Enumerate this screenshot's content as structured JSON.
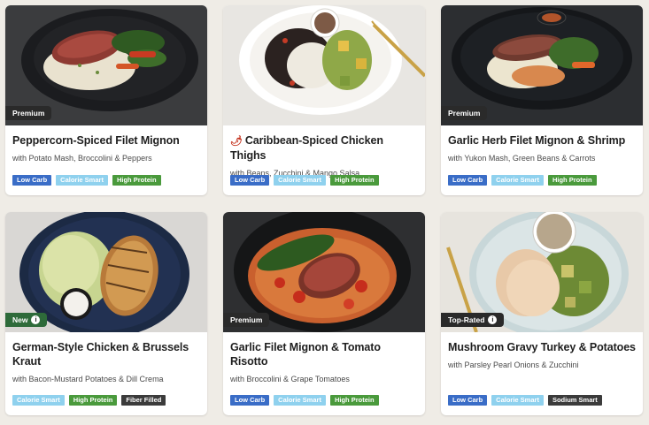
{
  "colors": {
    "page_bg": "#efece6",
    "low_carb": "#3a6dc7",
    "calorie_smart": "#8fd1ee",
    "high_protein": "#4a9a3c",
    "dark_badge": "#3b3b3b",
    "new_tag": "#2e6b3a"
  },
  "cards": [
    {
      "tag": "Premium",
      "title": "Peppercorn-Spiced Filet Mignon",
      "subtitle": "with Potato Mash, Broccolini & Peppers",
      "badges": [
        "Low Carb",
        "Calorie Smart",
        "High Protein"
      ]
    },
    {
      "tag": "",
      "icon": "chili-pepper-icon",
      "title": "Caribbean-Spiced Chicken Thighs",
      "subtitle": "with Beans, Zucchini & Mango Salsa",
      "badges": [
        "Low Carb",
        "Calorie Smart",
        "High Protein"
      ]
    },
    {
      "tag": "Premium",
      "title": "Garlic Herb Filet Mignon & Shrimp",
      "subtitle": "with Yukon Mash, Green Beans & Carrots",
      "badges": [
        "Low Carb",
        "Calorie Smart",
        "High Protein"
      ]
    },
    {
      "tag": "New",
      "title": "German-Style Chicken & Brussels Kraut",
      "subtitle": "with Bacon-Mustard Potatoes & Dill Crema",
      "badges": [
        "Calorie Smart",
        "High Protein",
        "Fiber Filled"
      ]
    },
    {
      "tag": "Premium",
      "title": "Garlic Filet Mignon & Tomato Risotto",
      "subtitle": "with Broccolini & Grape Tomatoes",
      "badges": [
        "Low Carb",
        "Calorie Smart",
        "High Protein"
      ]
    },
    {
      "tag": "Top-Rated",
      "title": "Mushroom Gravy Turkey & Potatoes",
      "subtitle": "with Parsley Pearl Onions & Zucchini",
      "badges": [
        "Low Carb",
        "Calorie Smart",
        "Sodium Smart"
      ]
    }
  ]
}
